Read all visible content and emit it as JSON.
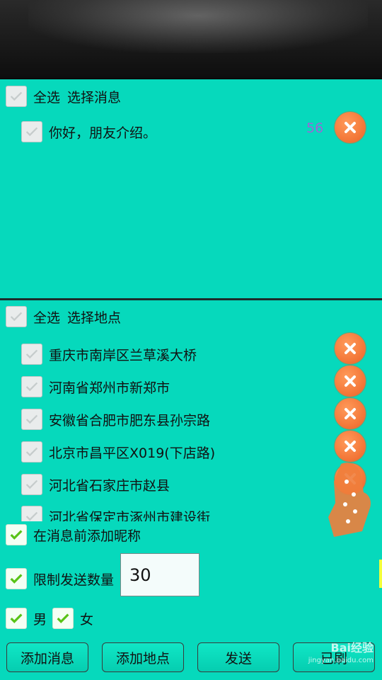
{
  "messages": {
    "select_all_label": "全选",
    "section_title": "选择消息",
    "items": [
      {
        "text": "你好，朋友介绍。",
        "count": "56"
      }
    ]
  },
  "locations": {
    "select_all_label": "全选",
    "section_title": "选择地点",
    "items": [
      "重庆市南岸区兰草溪大桥",
      "河南省郑州市新郑市",
      "安徽省合肥市肥东县孙宗路",
      "北京市昌平区X019(下店路)",
      "河北省石家庄市赵县",
      "河北省保定市涿州市建设街"
    ]
  },
  "options": {
    "add_nickname_label": "在消息前添加昵称",
    "limit_label": "限制发送数量",
    "limit_value": "30",
    "male_label": "男",
    "female_label": "女"
  },
  "buttons": {
    "add_message": "添加消息",
    "add_location": "添加地点",
    "send": "发送",
    "fourth_partial": "已刷"
  },
  "watermark": {
    "brand": "Bai经验",
    "url": "jingyan.baidu.com"
  },
  "colors": {
    "background": "#06d9bc",
    "delete_button": "#f4793a",
    "count_text": "#9b67d8",
    "check_on": "#58c316"
  }
}
